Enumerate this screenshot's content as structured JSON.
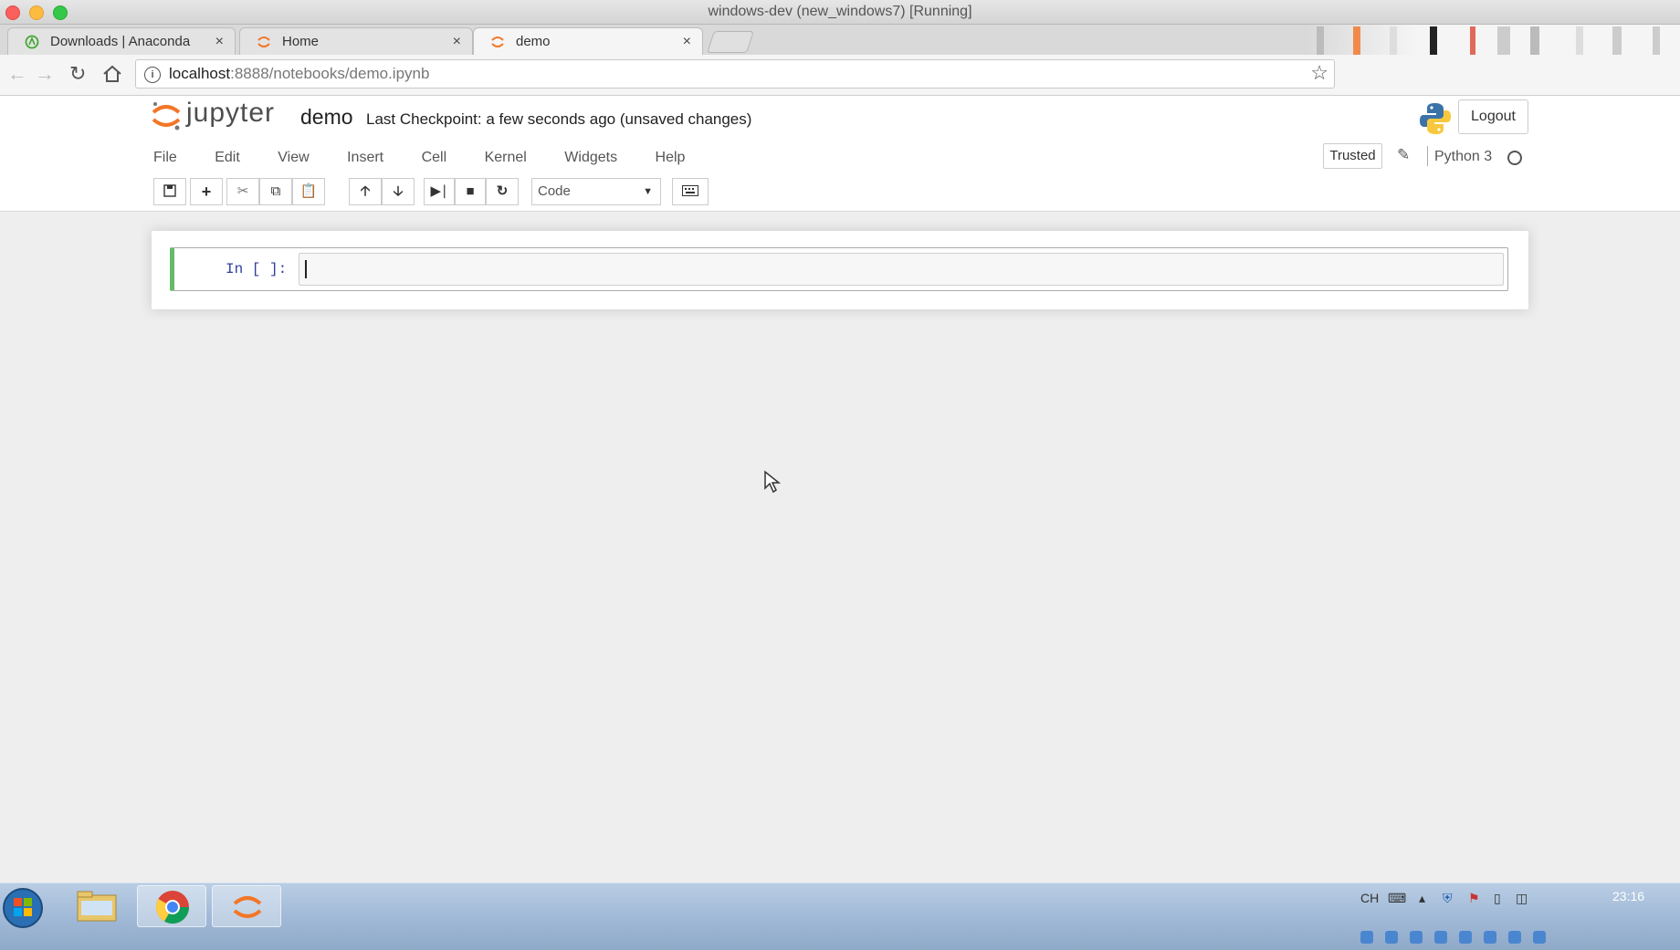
{
  "window": {
    "title": "windows-dev (new_windows7) [Running]"
  },
  "browser": {
    "tabs": [
      {
        "label": "Downloads | Anaconda",
        "icon": "anaconda-icon",
        "close": "×"
      },
      {
        "label": "Home",
        "icon": "jupyter-icon",
        "close": "×"
      },
      {
        "label": "demo",
        "icon": "jupyter-icon",
        "close": "×",
        "active": true
      }
    ],
    "address": {
      "host": "localhost",
      "path": ":8888/notebooks/demo.ipynb"
    }
  },
  "jupyter": {
    "logo_text": "jupyter",
    "notebook_name": "demo",
    "checkpoint": "Last Checkpoint: a few seconds ago (unsaved changes)",
    "logout_label": "Logout",
    "menu": [
      "File",
      "Edit",
      "View",
      "Insert",
      "Cell",
      "Kernel",
      "Widgets",
      "Help"
    ],
    "trusted_label": "Trusted",
    "kernel_name": "Python 3",
    "toolbar": {
      "cell_type": "Code"
    }
  },
  "cell": {
    "prompt": "In [ ]:",
    "code": ""
  },
  "taskbar": {
    "language": "CH",
    "clock": "23:16"
  },
  "colors": {
    "accent": "#f37626",
    "cell_selected_border": "#66bb6a",
    "prompt_color": "#303f9f"
  }
}
